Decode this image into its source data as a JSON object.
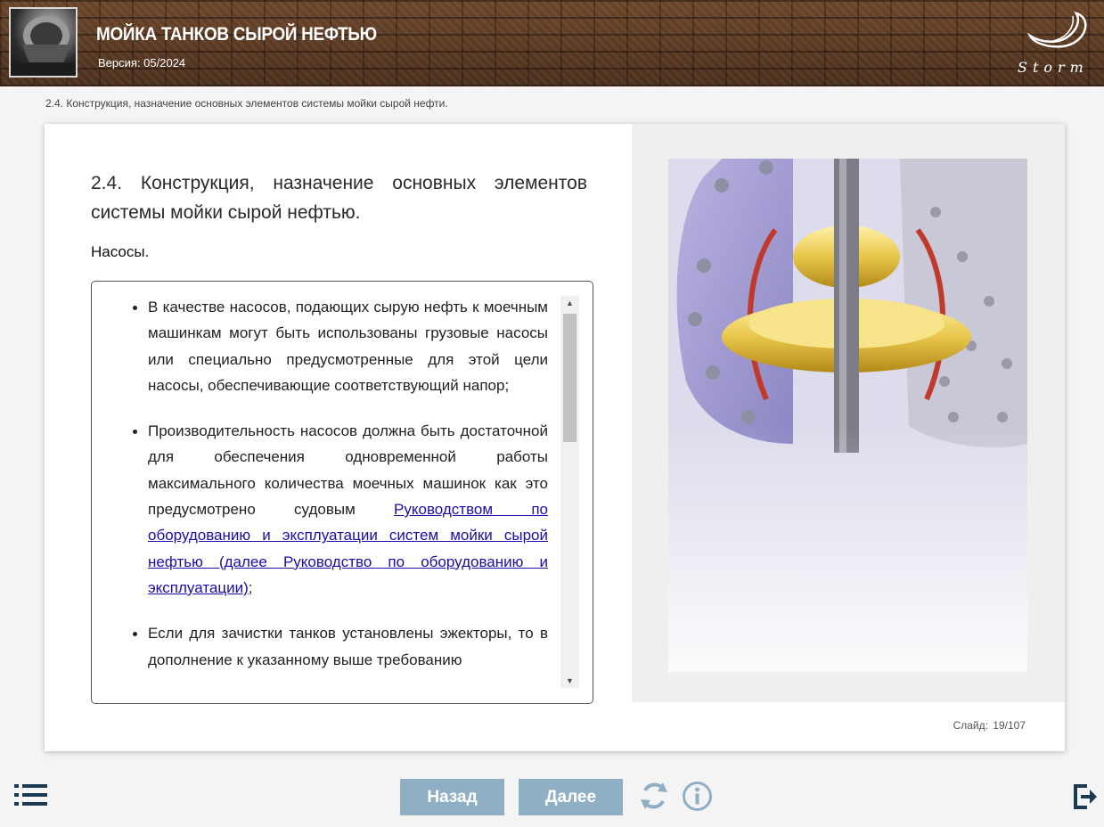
{
  "header": {
    "title": "МОЙКА ТАНКОВ СЫРОЙ НЕФТЬЮ",
    "version": "Версия: 05/2024",
    "logo_text": "Storm"
  },
  "breadcrumb": "2.4. Конструкция, назначение основных элементов системы мойки сырой нефти.",
  "slide": {
    "title_line1": "2.4. Конструкция, назначение основных элементов",
    "title_line2": "системы мойки сырой нефтью.",
    "subheading": "Насосы.",
    "bullets": {
      "b1": "В качестве насосов, подающих сырую нефть к моечным машинкам могут быть использованы грузовые насосы или специально предусмотренные для этой цели насосы, обеспечивающие соответствующий напор;",
      "b2_text": "Производительность насосов должна быть достаточной для обеспечения одновременной работы максимального количества моечных машинок как это предусмотрено судовым ",
      "b2_link": "Руководством по оборудованию и эксплуатации систем мойки сырой нефтью (далее Руководство по оборудованию и эксплуатации)",
      "b2_end": ";",
      "b3": "Если для зачистки танков установлены эжекторы, то в дополнение к указанному выше требованию"
    },
    "counter": "Слайд: 19/107"
  },
  "nav": {
    "back_label": "Назад",
    "next_label": "Далее",
    "menu_icon": "menu-list-icon",
    "replay_icon": "replay-icon",
    "info_icon": "info-icon",
    "exit_icon": "exit-icon"
  },
  "colors": {
    "button_bg": "#8fb0c4",
    "link": "#1a0dab",
    "nav_icon": "#1b3a52",
    "header_bg": "#5a3a22"
  }
}
